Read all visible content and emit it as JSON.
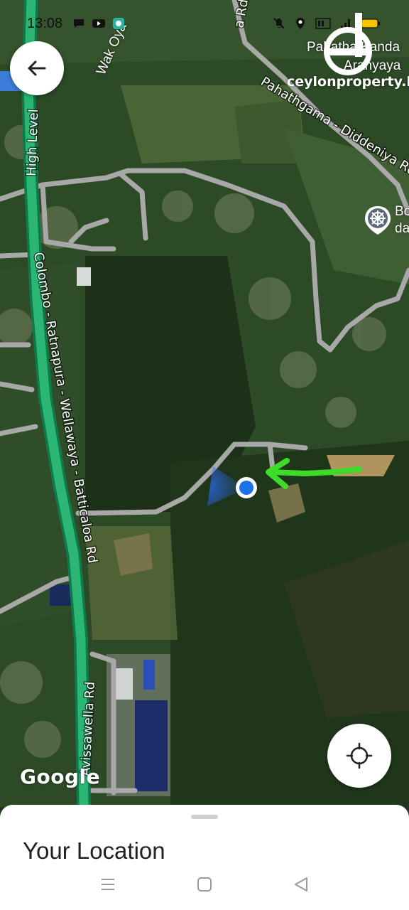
{
  "status_bar": {
    "time": "13:08",
    "icons": [
      "chat-bubble-icon",
      "youtube-icon",
      "message-app-icon",
      "mute-icon",
      "location-icon",
      "volte-icon",
      "signal-icon",
      "battery-icon"
    ]
  },
  "map": {
    "road_labels": {
      "highway_upper": "High Level",
      "highway_main": "Colombo - Ratnapura - Wellawaya - Batticaloa Rd",
      "pahathgama": "Pahathgama - Diddeniya Rd",
      "avissawella": "Avissawella Rd",
      "top_road": "a Rd"
    },
    "place_labels": {
      "stream": "Wak Oya",
      "aranya_line1": "Pahatha Kanda",
      "aranya_line2": "Aranyaya"
    },
    "poi": {
      "icon": "dharma-wheel-icon",
      "line1": "Bo",
      "line2": "da"
    },
    "attribution": "Google",
    "watermark": "ceylonproperty.lk",
    "colors": {
      "highway": "#2bb673",
      "road": "#a8a8a8",
      "arrow": "#3ddc2a",
      "location_dot": "#1a73e8"
    }
  },
  "back_button": {
    "icon": "arrow-left-icon"
  },
  "locate_button": {
    "icon": "crosshair-icon"
  },
  "sheet": {
    "title": "Your Location"
  },
  "nav_bar": {
    "buttons": [
      "recents-icon",
      "home-icon",
      "back-triangle-icon"
    ]
  }
}
